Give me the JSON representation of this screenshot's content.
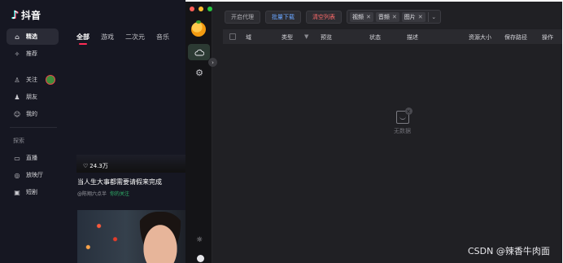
{
  "douyin": {
    "app_name": "抖音",
    "nav": [
      {
        "label": "精选",
        "icon": "home-icon",
        "active": true
      },
      {
        "label": "推荐",
        "icon": "compass-icon"
      },
      {
        "label": "关注",
        "icon": "user-follow-icon"
      },
      {
        "label": "朋友",
        "icon": "friends-icon"
      },
      {
        "label": "我的",
        "icon": "profile-icon"
      }
    ],
    "section_label": "探索",
    "explore": [
      {
        "label": "直播",
        "icon": "live-icon"
      },
      {
        "label": "放映厅",
        "icon": "cinema-icon"
      },
      {
        "label": "短剧",
        "icon": "drama-icon"
      }
    ],
    "tabs": [
      "全部",
      "游戏",
      "二次元",
      "音乐"
    ],
    "card": {
      "likes": "24.3万",
      "title": "当人生大事都需要请假来完成",
      "author": "@陈翔六点半",
      "follow_badge": "你的关注"
    }
  },
  "tool": {
    "toolbar": {
      "proxy_label": "开启代理",
      "batch_label": "批量下载",
      "clear_label": "清空列表",
      "filters": [
        "视频",
        "音频",
        "图片"
      ]
    },
    "table": {
      "columns": [
        "域",
        "类型",
        "预览",
        "状态",
        "描述",
        "资源大小",
        "保存路径",
        "操作"
      ],
      "empty_text": "无数据"
    },
    "colors": {
      "accent_green": "#2c3a33",
      "batch_blue": "#6aa6ff",
      "clear_red": "#ff6b6b"
    }
  },
  "watermark": "CSDN @辣香牛肉面"
}
